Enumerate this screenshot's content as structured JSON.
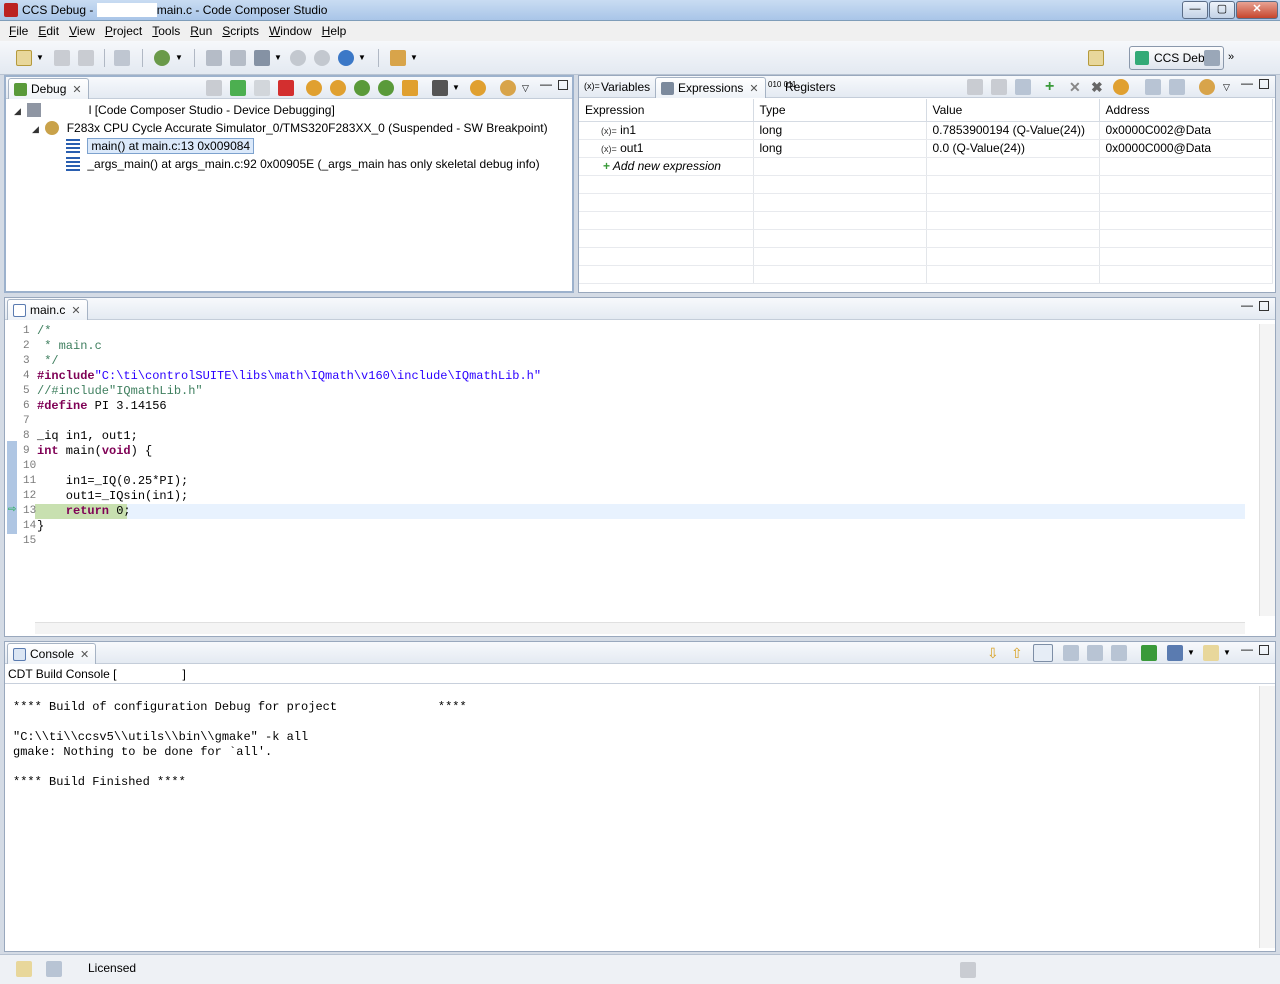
{
  "window": {
    "title_prefix": "CCS Debug - ",
    "title_suffix": "main.c - Code Composer Studio",
    "controls": {
      "minimize": "—",
      "maximize": "▢",
      "close": "✕"
    }
  },
  "menu": [
    "File",
    "Edit",
    "View",
    "Project",
    "Tools",
    "Run",
    "Scripts",
    "Window",
    "Help"
  ],
  "menu_mnemonics": [
    "F",
    "E",
    "V",
    "P",
    "T",
    "R",
    "S",
    "W",
    "H"
  ],
  "perspective": {
    "label": "CCS Debug",
    "more": "»"
  },
  "debug_view": {
    "tab_label": "Debug",
    "tree": [
      {
        "level": 0,
        "label": "l [Code Composer Studio - Device Debugging]",
        "icon": "debug-session-icon"
      },
      {
        "level": 1,
        "label": "F283x CPU Cycle Accurate Simulator_0/TMS320F283XX_0 (Suspended - SW Breakpoint)",
        "icon": "cpu-thread-icon"
      },
      {
        "level": 2,
        "label": "main() at main.c:13 0x009084",
        "icon": "stack-frame-icon",
        "selected": true
      },
      {
        "level": 2,
        "label": "_args_main() at args_main.c:92 0x00905E  (_args_main has only skeletal debug info)",
        "icon": "stack-frame-icon"
      }
    ]
  },
  "variables_view": {
    "tabs": [
      {
        "label": "Variables",
        "icon": "variables-icon"
      },
      {
        "label": "Expressions",
        "icon": "expressions-icon",
        "active": true
      },
      {
        "label": "Registers",
        "icon": "registers-icon"
      }
    ],
    "columns": [
      "Expression",
      "Type",
      "Value",
      "Address"
    ],
    "rows": [
      {
        "expression": "in1",
        "type": "long",
        "value": "0.7853900194 (Q-Value(24))",
        "address": "0x0000C002@Data"
      },
      {
        "expression": "out1",
        "type": "long",
        "value": "0.0 (Q-Value(24))",
        "address": "0x0000C000@Data"
      }
    ],
    "var_prefix": "(x)=",
    "add_new": "Add new expression"
  },
  "editor": {
    "tab_label": "main.c",
    "current_line": 13,
    "line_numbers": [
      "1",
      "2",
      "3",
      "4",
      "5",
      "6",
      "7",
      "8",
      "9",
      "10",
      "11",
      "12",
      "13",
      "14",
      "15"
    ],
    "lines": {
      "l1": "/*",
      "l2": " * main.c",
      "l3": " */",
      "l4_kw": "#include",
      "l4_str": "\"C:\\ti\\controlSUITE\\libs\\math\\IQmath\\v160\\include\\IQmathLib.h\"",
      "l5": "//#include\"IQmathLib.h\"",
      "l6_kw": "#define",
      "l6_rest": " PI 3.14156",
      "l8": "_iq in1, out1;",
      "l9_kw1": "int",
      "l9_mid": " main(",
      "l9_kw2": "void",
      "l9_end": ") {",
      "l11": "    in1=_IQ(0.25*PI);",
      "l12": "    out1=_IQsin(in1);",
      "l13_kw": "    return",
      "l13_rest": " 0;",
      "l14": "}"
    }
  },
  "console": {
    "tab_label": "Console",
    "subtitle": "CDT Build Console [",
    "subtitle_end": "]",
    "lines": [
      "**** Build of configuration Debug for project              ****",
      "",
      "\"C:\\\\ti\\\\ccsv5\\\\utils\\\\bin\\\\gmake\" -k all",
      "gmake: Nothing to be done for `all'.",
      "",
      "**** Build Finished ****"
    ]
  },
  "status": {
    "license": "Licensed"
  },
  "colors": {
    "selection": "#dbe9fa",
    "current_line": "#c8e0b0",
    "keyword": "#7f0055",
    "string": "#2a00ff",
    "comment": "#3f7f5f"
  }
}
